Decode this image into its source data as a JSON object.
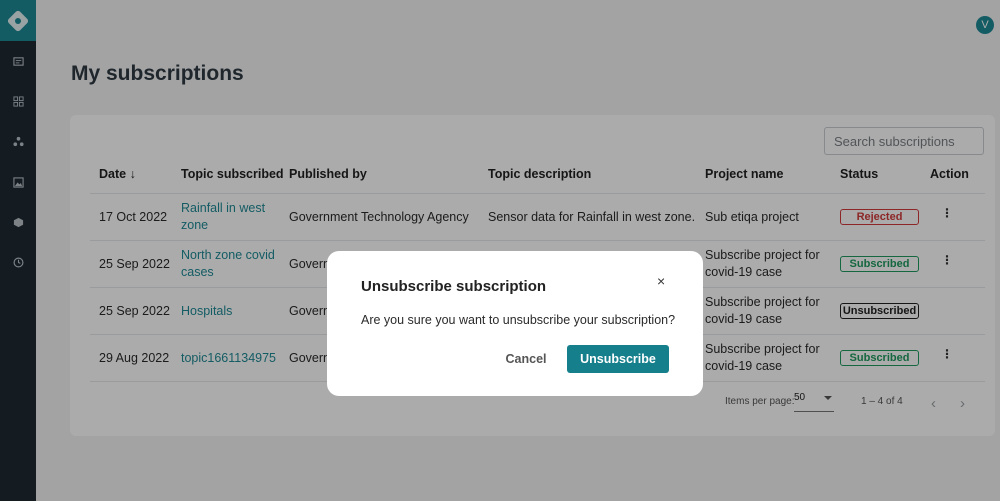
{
  "app": {
    "avatar_initial": "V"
  },
  "sidebar": {
    "items": [
      {
        "icon": "news-icon"
      },
      {
        "icon": "grid-icon"
      },
      {
        "icon": "network-icon"
      },
      {
        "icon": "image-icon"
      },
      {
        "icon": "cube-icon"
      },
      {
        "icon": "clock-icon"
      }
    ]
  },
  "page": {
    "title": "My subscriptions"
  },
  "search": {
    "placeholder": "Search subscriptions"
  },
  "table": {
    "columns": [
      "Date ↓",
      "Topic subscribed",
      "Published by",
      "Topic description",
      "Project name",
      "Status",
      "Action"
    ],
    "rows": [
      {
        "date": "17 Oct 2022",
        "topic": [
          "Rainfall in west",
          "zone"
        ],
        "publisher": "Government Technology Agency",
        "description": "Sensor data for Rainfall in west zone.",
        "project": [
          "Sub etiqa project",
          ""
        ],
        "status": "Rejected",
        "action": "⋮"
      },
      {
        "date": "25 Sep 2022",
        "topic": [
          "North zone covid",
          "cases"
        ],
        "publisher": "Govern",
        "description": "",
        "project": [
          "Subscribe project for",
          "covid-19 case"
        ],
        "status": "Subscribed",
        "action": "⋮"
      },
      {
        "date": "25 Sep 2022",
        "topic": [
          "Hospitals",
          ""
        ],
        "publisher": "Govern",
        "description": "",
        "project": [
          "Subscribe project for",
          "covid-19 case"
        ],
        "status": "Unsubscribed",
        "action": ""
      },
      {
        "date": "29 Aug 2022",
        "topic": [
          "topic1661134975",
          ""
        ],
        "publisher": "Govern",
        "description": "",
        "project": [
          "Subscribe project for",
          "covid-19 case"
        ],
        "status": "Subscribed",
        "action": "⋮"
      }
    ]
  },
  "pagination": {
    "items_per_page_label": "Items per page:",
    "items_per_page": "50",
    "range": "1 – 4 of 4",
    "prev": "‹",
    "next": "›"
  },
  "dialog": {
    "title": "Unsubscribe subscription",
    "close": "×",
    "message": "Are you sure you want to unsubscribe your subscription?",
    "cancel_label": "Cancel",
    "confirm_label": "Unsubscribe"
  },
  "colors": {
    "accent": "#1f8a96",
    "rejected": "#d23b3b",
    "subscribed": "#1f9a5e"
  }
}
